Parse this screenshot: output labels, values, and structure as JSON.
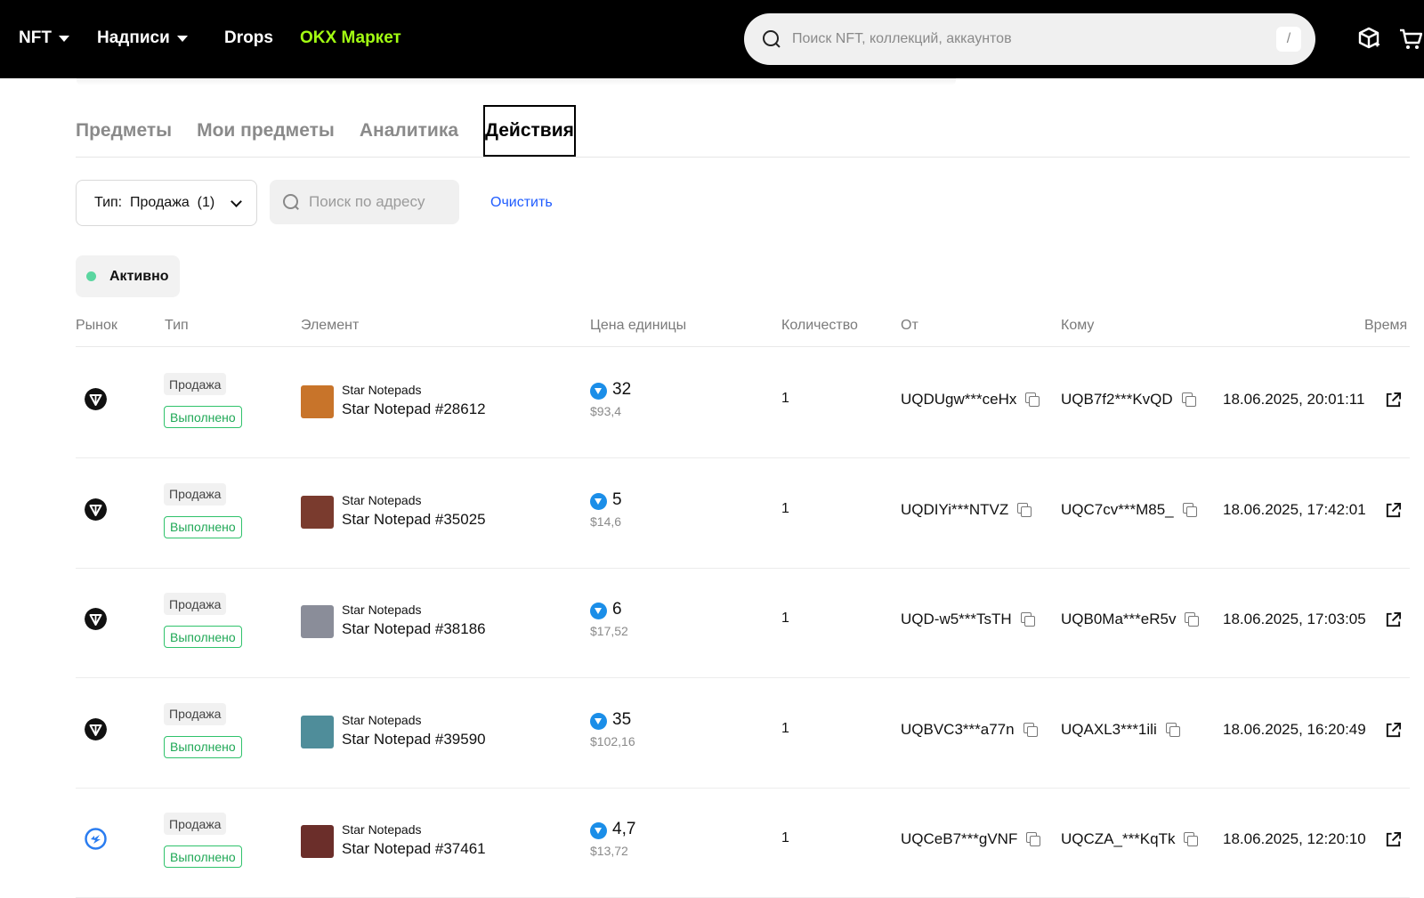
{
  "topnav": {
    "items": [
      {
        "label": "NFT",
        "has_caret": true
      },
      {
        "label": "Надписи",
        "has_caret": true
      },
      {
        "label": "Drops",
        "has_caret": false
      },
      {
        "label": "OKX Маркет",
        "has_caret": false,
        "accent": "#a3ff12"
      }
    ],
    "search_placeholder": "Поиск NFT, коллекций, аккаунтов",
    "search_shortcut": "/",
    "icons": [
      "cube-icon",
      "cart-icon"
    ]
  },
  "tabs": [
    {
      "label": "Предметы",
      "active": false
    },
    {
      "label": "Мои предметы",
      "active": false
    },
    {
      "label": "Аналитика",
      "active": false
    },
    {
      "label": "Действия",
      "active": true
    }
  ],
  "filters": {
    "type_label": "Тип:  Продажа  (1)",
    "address_placeholder": "Поиск по адресу",
    "clear_label": "Очистить",
    "status_label": "Активно",
    "status_color": "#5bd6a0"
  },
  "table": {
    "headers": {
      "market": "Рынок",
      "type": "Тип",
      "element": "Элемент",
      "unit_price": "Цена единицы",
      "quantity": "Количество",
      "from": "От",
      "to": "Кому",
      "time": "Время"
    },
    "rows": [
      {
        "market_icon": "okx-market-icon",
        "type": "Продажа",
        "status": "Выполнено",
        "collection": "Star Notepads",
        "name": "Star Notepad #28612",
        "thumb_color": "#c8742a",
        "price": "32",
        "usd": "$93,4",
        "qty": "1",
        "from": "UQDUgw***ceHx",
        "to": "UQB7f2***KvQD",
        "time": "18.06.2025, 20:01:11"
      },
      {
        "market_icon": "okx-market-icon",
        "type": "Продажа",
        "status": "Выполнено",
        "collection": "Star Notepads",
        "name": "Star Notepad #35025",
        "thumb_color": "#7a3b2e",
        "price": "5",
        "usd": "$14,6",
        "qty": "1",
        "from": "UQDIYi***NTVZ",
        "to": "UQC7cv***M85_",
        "time": "18.06.2025, 17:42:01"
      },
      {
        "market_icon": "okx-market-icon",
        "type": "Продажа",
        "status": "Выполнено",
        "collection": "Star Notepads",
        "name": "Star Notepad #38186",
        "thumb_color": "#8a8d99",
        "price": "6",
        "usd": "$17,52",
        "qty": "1",
        "from": "UQD-w5***TsTH",
        "to": "UQB0Ma***eR5v",
        "time": "18.06.2025, 17:03:05"
      },
      {
        "market_icon": "okx-market-icon",
        "type": "Продажа",
        "status": "Выполнено",
        "collection": "Star Notepads",
        "name": "Star Notepad #39590",
        "thumb_color": "#4f8d9a",
        "price": "35",
        "usd": "$102,16",
        "qty": "1",
        "from": "UQBVC3***a77n",
        "to": "UQAXL3***1ili",
        "time": "18.06.2025, 16:20:49"
      },
      {
        "market_icon": "getgems-market-icon",
        "type": "Продажа",
        "status": "Выполнено",
        "collection": "Star Notepads",
        "name": "Star Notepad #37461",
        "thumb_color": "#6b2e2a",
        "price": "4,7",
        "usd": "$13,72",
        "qty": "1",
        "from": "UQCeB7***gVNF",
        "to": "UQCZA_***KqTk",
        "time": "18.06.2025, 12:20:10"
      }
    ]
  },
  "colors": {
    "topbar_bg": "#000000",
    "accent_green": "#a3ff12",
    "link_blue": "#1f5cff",
    "success_green": "#1fa856",
    "ton_blue": "#1b8ee8"
  }
}
